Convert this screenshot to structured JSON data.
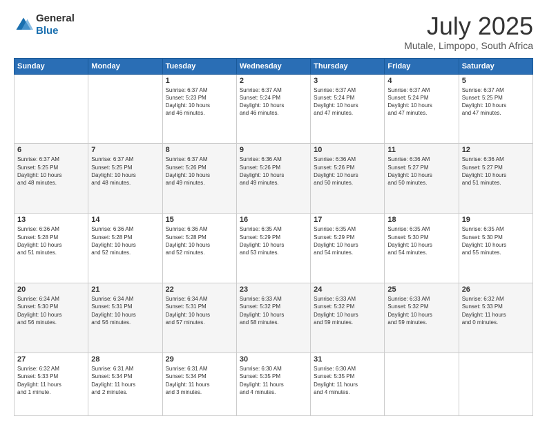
{
  "header": {
    "logo": {
      "general": "General",
      "blue": "Blue"
    },
    "title": "July 2025",
    "subtitle": "Mutale, Limpopo, South Africa"
  },
  "days_of_week": [
    "Sunday",
    "Monday",
    "Tuesday",
    "Wednesday",
    "Thursday",
    "Friday",
    "Saturday"
  ],
  "weeks": [
    [
      {
        "day": "",
        "content": ""
      },
      {
        "day": "",
        "content": ""
      },
      {
        "day": "1",
        "content": "Sunrise: 6:37 AM\nSunset: 5:23 PM\nDaylight: 10 hours\nand 46 minutes."
      },
      {
        "day": "2",
        "content": "Sunrise: 6:37 AM\nSunset: 5:24 PM\nDaylight: 10 hours\nand 46 minutes."
      },
      {
        "day": "3",
        "content": "Sunrise: 6:37 AM\nSunset: 5:24 PM\nDaylight: 10 hours\nand 47 minutes."
      },
      {
        "day": "4",
        "content": "Sunrise: 6:37 AM\nSunset: 5:24 PM\nDaylight: 10 hours\nand 47 minutes."
      },
      {
        "day": "5",
        "content": "Sunrise: 6:37 AM\nSunset: 5:25 PM\nDaylight: 10 hours\nand 47 minutes."
      }
    ],
    [
      {
        "day": "6",
        "content": "Sunrise: 6:37 AM\nSunset: 5:25 PM\nDaylight: 10 hours\nand 48 minutes."
      },
      {
        "day": "7",
        "content": "Sunrise: 6:37 AM\nSunset: 5:25 PM\nDaylight: 10 hours\nand 48 minutes."
      },
      {
        "day": "8",
        "content": "Sunrise: 6:37 AM\nSunset: 5:26 PM\nDaylight: 10 hours\nand 49 minutes."
      },
      {
        "day": "9",
        "content": "Sunrise: 6:36 AM\nSunset: 5:26 PM\nDaylight: 10 hours\nand 49 minutes."
      },
      {
        "day": "10",
        "content": "Sunrise: 6:36 AM\nSunset: 5:26 PM\nDaylight: 10 hours\nand 50 minutes."
      },
      {
        "day": "11",
        "content": "Sunrise: 6:36 AM\nSunset: 5:27 PM\nDaylight: 10 hours\nand 50 minutes."
      },
      {
        "day": "12",
        "content": "Sunrise: 6:36 AM\nSunset: 5:27 PM\nDaylight: 10 hours\nand 51 minutes."
      }
    ],
    [
      {
        "day": "13",
        "content": "Sunrise: 6:36 AM\nSunset: 5:28 PM\nDaylight: 10 hours\nand 51 minutes."
      },
      {
        "day": "14",
        "content": "Sunrise: 6:36 AM\nSunset: 5:28 PM\nDaylight: 10 hours\nand 52 minutes."
      },
      {
        "day": "15",
        "content": "Sunrise: 6:36 AM\nSunset: 5:28 PM\nDaylight: 10 hours\nand 52 minutes."
      },
      {
        "day": "16",
        "content": "Sunrise: 6:35 AM\nSunset: 5:29 PM\nDaylight: 10 hours\nand 53 minutes."
      },
      {
        "day": "17",
        "content": "Sunrise: 6:35 AM\nSunset: 5:29 PM\nDaylight: 10 hours\nand 54 minutes."
      },
      {
        "day": "18",
        "content": "Sunrise: 6:35 AM\nSunset: 5:30 PM\nDaylight: 10 hours\nand 54 minutes."
      },
      {
        "day": "19",
        "content": "Sunrise: 6:35 AM\nSunset: 5:30 PM\nDaylight: 10 hours\nand 55 minutes."
      }
    ],
    [
      {
        "day": "20",
        "content": "Sunrise: 6:34 AM\nSunset: 5:30 PM\nDaylight: 10 hours\nand 56 minutes."
      },
      {
        "day": "21",
        "content": "Sunrise: 6:34 AM\nSunset: 5:31 PM\nDaylight: 10 hours\nand 56 minutes."
      },
      {
        "day": "22",
        "content": "Sunrise: 6:34 AM\nSunset: 5:31 PM\nDaylight: 10 hours\nand 57 minutes."
      },
      {
        "day": "23",
        "content": "Sunrise: 6:33 AM\nSunset: 5:32 PM\nDaylight: 10 hours\nand 58 minutes."
      },
      {
        "day": "24",
        "content": "Sunrise: 6:33 AM\nSunset: 5:32 PM\nDaylight: 10 hours\nand 59 minutes."
      },
      {
        "day": "25",
        "content": "Sunrise: 6:33 AM\nSunset: 5:32 PM\nDaylight: 10 hours\nand 59 minutes."
      },
      {
        "day": "26",
        "content": "Sunrise: 6:32 AM\nSunset: 5:33 PM\nDaylight: 11 hours\nand 0 minutes."
      }
    ],
    [
      {
        "day": "27",
        "content": "Sunrise: 6:32 AM\nSunset: 5:33 PM\nDaylight: 11 hours\nand 1 minute."
      },
      {
        "day": "28",
        "content": "Sunrise: 6:31 AM\nSunset: 5:34 PM\nDaylight: 11 hours\nand 2 minutes."
      },
      {
        "day": "29",
        "content": "Sunrise: 6:31 AM\nSunset: 5:34 PM\nDaylight: 11 hours\nand 3 minutes."
      },
      {
        "day": "30",
        "content": "Sunrise: 6:30 AM\nSunset: 5:35 PM\nDaylight: 11 hours\nand 4 minutes."
      },
      {
        "day": "31",
        "content": "Sunrise: 6:30 AM\nSunset: 5:35 PM\nDaylight: 11 hours\nand 4 minutes."
      },
      {
        "day": "",
        "content": ""
      },
      {
        "day": "",
        "content": ""
      }
    ]
  ]
}
